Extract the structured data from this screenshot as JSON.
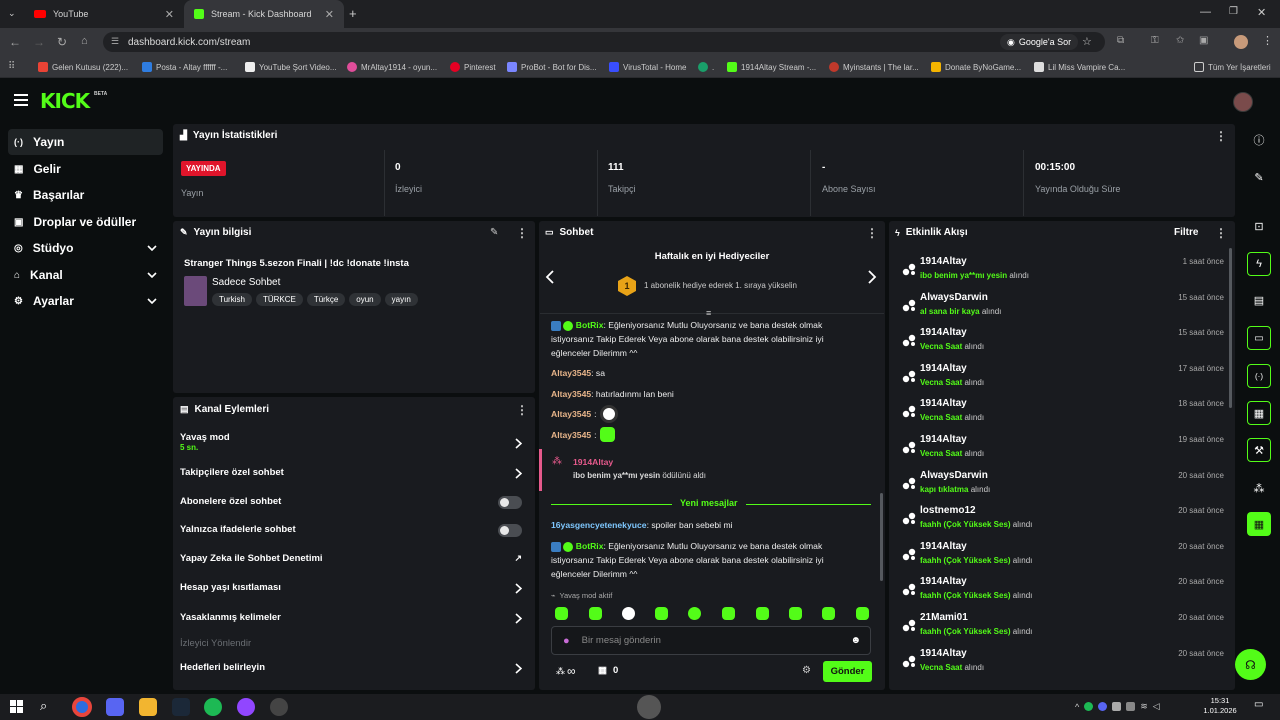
{
  "browser": {
    "tabs": [
      {
        "label": "YouTube",
        "active": false
      },
      {
        "label": "Stream - Kick Dashboard",
        "active": true
      }
    ],
    "url": "dashboard.kick.com/stream",
    "google_lens": "Google'a Sor",
    "bookmarks": [
      "Gelen Kutusu (222)...",
      "Posta - Altay ffffff -...",
      "YouTube Şort Video...",
      "MrAltay1914 - oyun...",
      "Pinterest",
      "ProBot - Bot for Dis...",
      "VirusTotal - Home",
      ".",
      "1914Altay Stream -...",
      "Myinstants | The lar...",
      "Donate ByNoGame...",
      "Lil Miss Vampire Ca..."
    ],
    "all_bookmarks": "Tüm Yer İşaretleri"
  },
  "app": {
    "logo": "KICK",
    "logo_badge": "BETA"
  },
  "sidebar": {
    "items": [
      {
        "label": "Yayın",
        "icon": "broadcast-icon",
        "active": true,
        "chevron": false
      },
      {
        "label": "Gelir",
        "icon": "revenue-icon",
        "active": false,
        "chevron": false
      },
      {
        "label": "Başarılar",
        "icon": "trophy-icon",
        "active": false,
        "chevron": false
      },
      {
        "label": "Droplar ve ödüller",
        "icon": "gift-icon",
        "active": false,
        "chevron": false
      },
      {
        "label": "Stüdyo",
        "icon": "studio-icon",
        "active": false,
        "chevron": true
      },
      {
        "label": "Kanal",
        "icon": "channel-icon",
        "active": false,
        "chevron": true
      },
      {
        "label": "Ayarlar",
        "icon": "gear-icon",
        "active": false,
        "chevron": true
      }
    ]
  },
  "stats": {
    "title": "Yayın İstatistikleri",
    "live_badge": "YAYINDA",
    "cells": [
      {
        "value": "",
        "label": "Yayın"
      },
      {
        "value": "0",
        "label": "İzleyici"
      },
      {
        "value": "111",
        "label": "Takipçi"
      },
      {
        "value": "-",
        "label": "Abone Sayısı"
      },
      {
        "value": "00:15:00",
        "label": "Yayında Olduğu Süre"
      }
    ]
  },
  "stream_info": {
    "title": "Yayın bilgisi",
    "stream_title": "Stranger Things 5.sezon Finali | !dc !donate !insta",
    "category": "Sadece Sohbet",
    "tags": [
      "Turkish",
      "TÜRKCE",
      "Türkçe",
      "oyun",
      "yayın"
    ]
  },
  "channel_actions": {
    "title": "Kanal Eylemleri",
    "rows": [
      {
        "label": "Yavaş mod",
        "sub": "5 sn.",
        "control": "chevron"
      },
      {
        "label": "Takipçilere özel sohbet",
        "sub": "",
        "control": "chevron"
      },
      {
        "label": "Abonelere özel sohbet",
        "sub": "",
        "control": "toggle"
      },
      {
        "label": "Yalnızca ifadelerle sohbet",
        "sub": "",
        "control": "toggle"
      },
      {
        "label": "Yapay Zeka ile Sohbet Denetimi",
        "sub": "",
        "control": "external"
      },
      {
        "label": "Hesap yaşı kısıtlaması",
        "sub": "",
        "control": "chevron"
      },
      {
        "label": "Yasaklanmış kelimeler",
        "sub": "",
        "control": "chevron"
      },
      {
        "label": "İzleyici Yönlendir",
        "sub": "",
        "control": "none"
      },
      {
        "label": "Hedefleri belirleyin",
        "sub": "",
        "control": "chevron"
      }
    ]
  },
  "chat": {
    "title": "Sohbet",
    "gifters_title": "Haftalık en iyi Hediyeciler",
    "gifter_rank": "1",
    "gifters_text": "1 abonelik hediye ederek 1. sıraya yükselin",
    "messages_a": [
      {
        "user": "BotRix",
        "text": "Eğleniyorsanız Mutlu Oluyorsanız ve bana destek olmak istiyorsanız Takip Ederek Veya abone olarak bana destek olabilirsiniz iyi eğlenceler Dilerimm ^^"
      },
      {
        "user": "Altay3545",
        "text": "sa"
      },
      {
        "user": "Altay3545",
        "text": "hatırladınmı lan beni"
      },
      {
        "user": "Altay3545",
        "text": ""
      },
      {
        "user": "Altay3545",
        "text": ""
      }
    ],
    "reward_user": "1914Altay",
    "reward_text": "ibo benim ya**mı yesin",
    "reward_suffix": "ödülünü aldı",
    "new_messages": "Yeni mesajlar",
    "messages_b": [
      {
        "user": "16yasgencyetenekyuce",
        "text": "spoiler ban sebebi mi"
      },
      {
        "user": "BotRix",
        "text": "Eğleniyorsanız Mutlu Oluyorsanız ve bana destek olmak istiyorsanız Takip Ederek Veya abone olarak bana destek olabilirsiniz iyi eğlenceler Dilerimm ^^"
      }
    ],
    "slow_mode": "Yavaş mod aktif",
    "input_placeholder": "Bir mesaj gönderin",
    "points": "∞",
    "gift_count": "0",
    "send": "Gönder"
  },
  "activity": {
    "title": "Etkinlik Akışı",
    "filter": "Filtre",
    "suffix": "alındı",
    "events": [
      {
        "user": "1914Altay",
        "reward": "ibo benim ya**mı yesin",
        "time": "1 saat önce"
      },
      {
        "user": "AlwaysDarwin",
        "reward": "al sana bir kaya",
        "time": "15 saat önce"
      },
      {
        "user": "1914Altay",
        "reward": "Vecna Saat",
        "time": "15 saat önce"
      },
      {
        "user": "1914Altay",
        "reward": "Vecna Saat",
        "time": "17 saat önce"
      },
      {
        "user": "1914Altay",
        "reward": "Vecna Saat",
        "time": "18 saat önce"
      },
      {
        "user": "1914Altay",
        "reward": "Vecna Saat",
        "time": "19 saat önce"
      },
      {
        "user": "AlwaysDarwin",
        "reward": "kapı tıklatma",
        "time": "20 saat önce"
      },
      {
        "user": "lostnemo12",
        "reward": "faahh (Çok Yüksek Ses)",
        "time": "20 saat önce"
      },
      {
        "user": "1914Altay",
        "reward": "faahh (Çok Yüksek Ses)",
        "time": "20 saat önce"
      },
      {
        "user": "1914Altay",
        "reward": "faahh (Çok Yüksek Ses)",
        "time": "20 saat önce"
      },
      {
        "user": "21Mami01",
        "reward": "faahh (Çok Yüksek Ses)",
        "time": "20 saat önce"
      },
      {
        "user": "1914Altay",
        "reward": "Vecna Saat",
        "time": "20 saat önce"
      }
    ]
  },
  "taskbar": {
    "time": "15:31",
    "date": "1.01.2026"
  },
  "colors": {
    "accent": "#53fc18",
    "live": "#e0152b",
    "panel": "#191b1f"
  }
}
